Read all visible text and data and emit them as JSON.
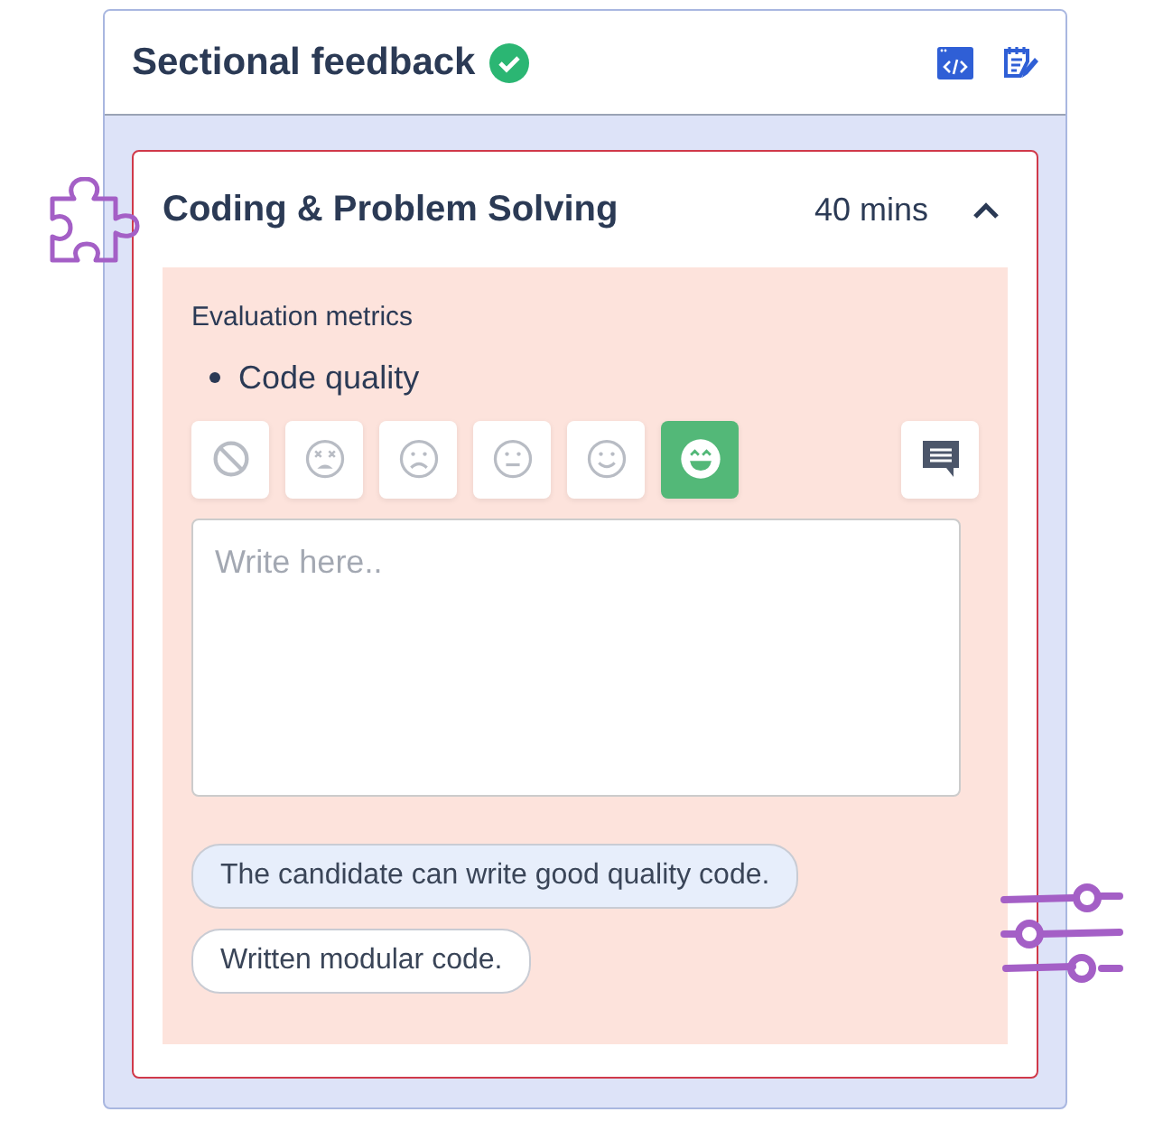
{
  "section": {
    "title": "Sectional feedback",
    "complete": true
  },
  "topic": {
    "title": "Coding & Problem Solving",
    "duration": "40 mins",
    "expanded": true
  },
  "metrics_label": "Evaluation metrics",
  "metrics": [
    "Code quality"
  ],
  "ratings": [
    {
      "kind": "none",
      "selected": false
    },
    {
      "kind": "awful",
      "selected": false
    },
    {
      "kind": "sad",
      "selected": false
    },
    {
      "kind": "neutral",
      "selected": false
    },
    {
      "kind": "smile",
      "selected": false
    },
    {
      "kind": "great",
      "selected": true
    }
  ],
  "comment": {
    "placeholder": "Write here.."
  },
  "suggestions": [
    {
      "text": "The candidate can write good quality code.",
      "selected": true
    },
    {
      "text": "Written modular code.",
      "selected": false
    }
  ]
}
